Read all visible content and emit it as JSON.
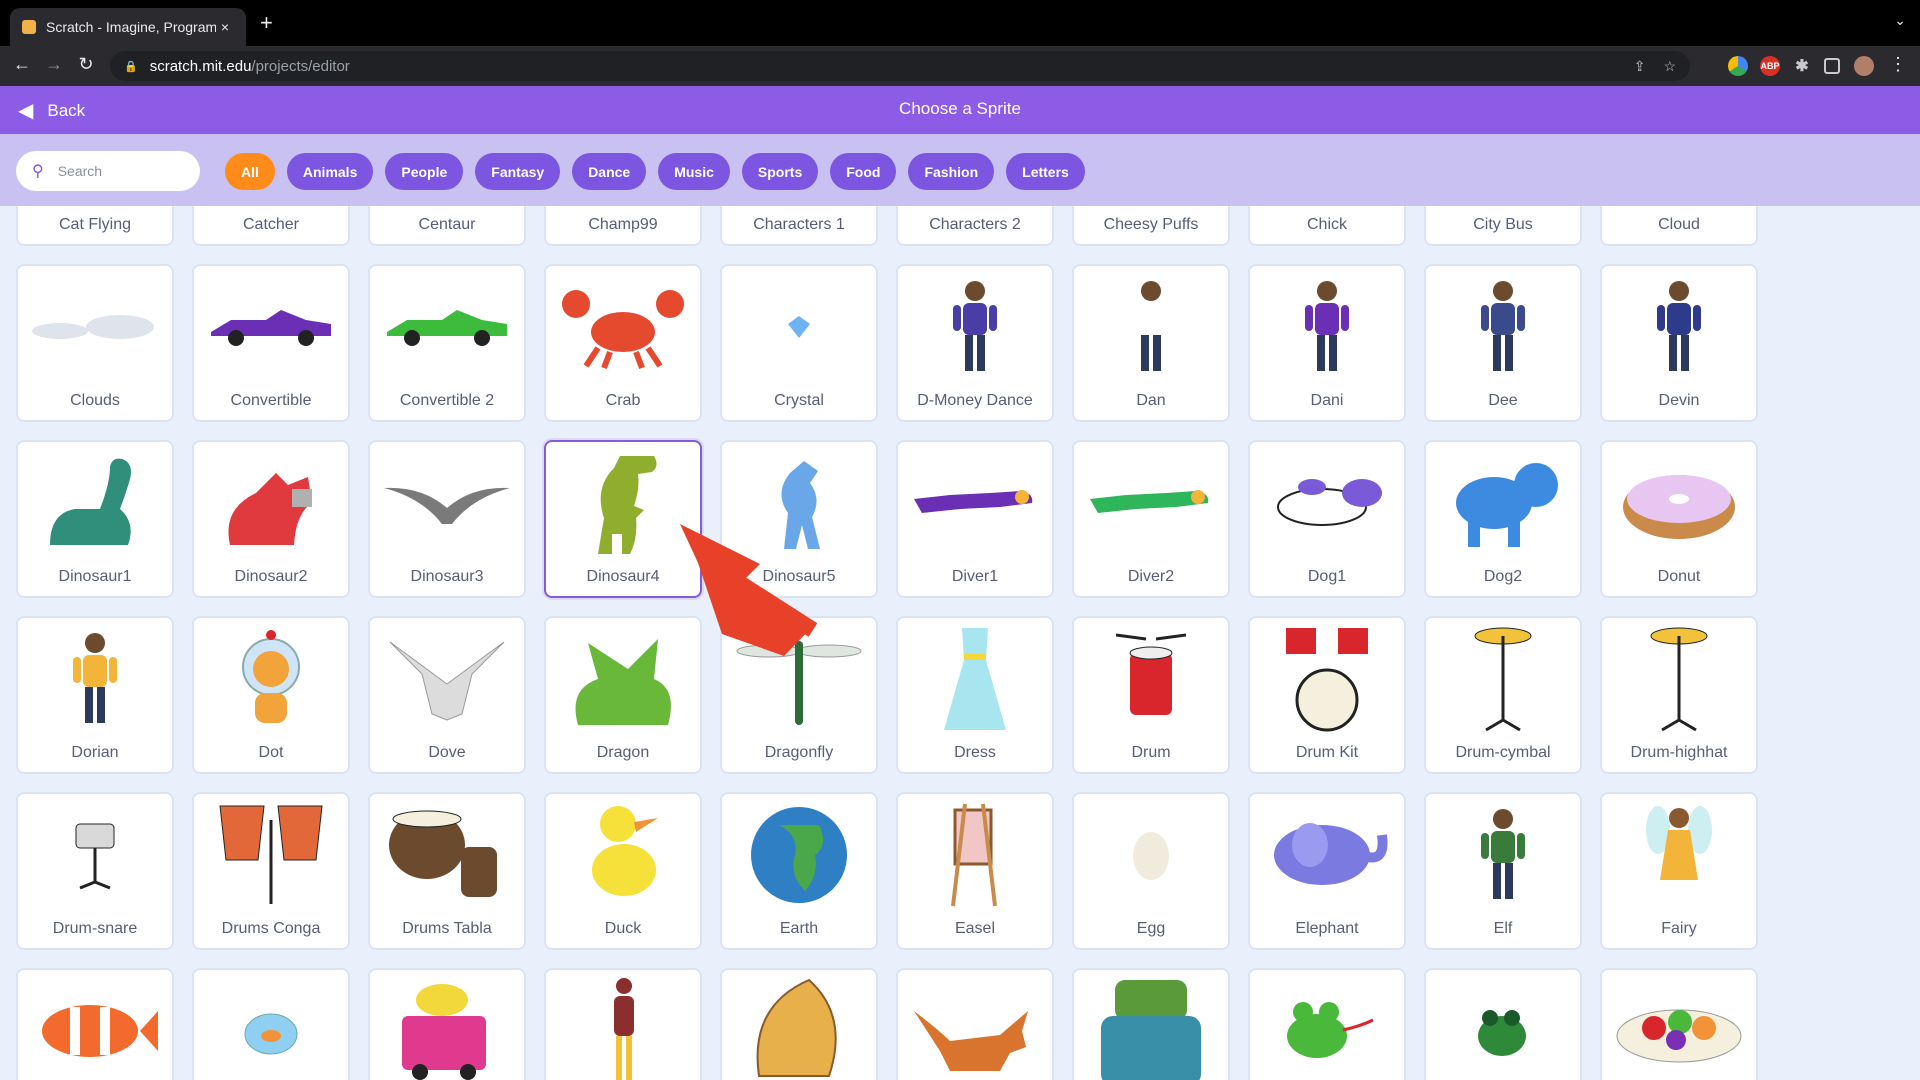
{
  "browser": {
    "tab_title": "Scratch - Imagine, Program, Share",
    "tab_close": "×",
    "new_tab": "+",
    "url_host": "scratch.mit.edu",
    "url_path": "/projects/editor",
    "extensions": [
      "drive-icon",
      "adblock-icon",
      "puzzle-icon",
      "sidepanel-icon",
      "profile-avatar"
    ]
  },
  "header": {
    "back_label": "Back",
    "title": "Choose a Sprite"
  },
  "search": {
    "placeholder": "Search",
    "value": ""
  },
  "categories": [
    {
      "label": "All",
      "active": true
    },
    {
      "label": "Animals",
      "active": false
    },
    {
      "label": "People",
      "active": false
    },
    {
      "label": "Fantasy",
      "active": false
    },
    {
      "label": "Dance",
      "active": false
    },
    {
      "label": "Music",
      "active": false
    },
    {
      "label": "Sports",
      "active": false
    },
    {
      "label": "Food",
      "active": false
    },
    {
      "label": "Fashion",
      "active": false
    },
    {
      "label": "Letters",
      "active": false
    }
  ],
  "sprites": [
    {
      "name": "Cat Flying",
      "icon": "cat-flying",
      "color": "#f7a934"
    },
    {
      "name": "Catcher",
      "icon": "catcher",
      "color": "#4c6ed8"
    },
    {
      "name": "Centaur",
      "icon": "centaur",
      "color": "#b07f4a"
    },
    {
      "name": "Champ99",
      "icon": "champ",
      "color": "#c43a3a"
    },
    {
      "name": "Characters 1",
      "icon": "characters",
      "color": "#6a5acd"
    },
    {
      "name": "Characters 2",
      "icon": "characters",
      "color": "#3a9fc4"
    },
    {
      "name": "Cheesy Puffs",
      "icon": "cheesy-puffs",
      "color": "#f6b53a"
    },
    {
      "name": "Chick",
      "icon": "chick",
      "color": "#f6d83a"
    },
    {
      "name": "City Bus",
      "icon": "city-bus",
      "color": "#e2473a"
    },
    {
      "name": "Cloud",
      "icon": "cloud",
      "color": "#dfe6ef"
    },
    {
      "name": "Clouds",
      "icon": "clouds",
      "color": "#dfe3ec"
    },
    {
      "name": "Convertible",
      "icon": "convertible",
      "color": "#6a2fb5"
    },
    {
      "name": "Convertible 2",
      "icon": "convertible2",
      "color": "#3dbb3d"
    },
    {
      "name": "Crab",
      "icon": "crab",
      "color": "#e64a2e"
    },
    {
      "name": "Crystal",
      "icon": "crystal",
      "color": "#6fb3f2"
    },
    {
      "name": "D-Money Dance",
      "icon": "person",
      "color": "#4a3da8"
    },
    {
      "name": "Dan",
      "icon": "person",
      "color": "#ffffff"
    },
    {
      "name": "Dani",
      "icon": "person",
      "color": "#6a2fb5"
    },
    {
      "name": "Dee",
      "icon": "person",
      "color": "#3b4a8a"
    },
    {
      "name": "Devin",
      "icon": "person",
      "color": "#2e3a8a"
    },
    {
      "name": "Dinosaur1",
      "icon": "dinosaur",
      "color": "#2f8f7a"
    },
    {
      "name": "Dinosaur2",
      "icon": "dinosaur2",
      "color": "#e0393e"
    },
    {
      "name": "Dinosaur3",
      "icon": "pterodactyl",
      "color": "#7a7a7a"
    },
    {
      "name": "Dinosaur4",
      "icon": "trex",
      "color": "#8fae2e"
    },
    {
      "name": "Dinosaur5",
      "icon": "dinosaur5",
      "color": "#6aa7e8"
    },
    {
      "name": "Diver1",
      "icon": "diver",
      "color": "#6a2fb5"
    },
    {
      "name": "Diver2",
      "icon": "diver",
      "color": "#2fb55a"
    },
    {
      "name": "Dog1",
      "icon": "dog1",
      "color": "#7a5ad6"
    },
    {
      "name": "Dog2",
      "icon": "dog2",
      "color": "#3d8be0"
    },
    {
      "name": "Donut",
      "icon": "donut",
      "color": "#c98a4a"
    },
    {
      "name": "Dorian",
      "icon": "person",
      "color": "#f2b53a"
    },
    {
      "name": "Dot",
      "icon": "dot",
      "color": "#f2a33a"
    },
    {
      "name": "Dove",
      "icon": "dove",
      "color": "#dcdcdc"
    },
    {
      "name": "Dragon",
      "icon": "dragon",
      "color": "#6ab83a"
    },
    {
      "name": "Dragonfly",
      "icon": "dragonfly",
      "color": "#2e6b3a"
    },
    {
      "name": "Dress",
      "icon": "dress",
      "color": "#a8e6ef"
    },
    {
      "name": "Drum",
      "icon": "drum",
      "color": "#d9262c"
    },
    {
      "name": "Drum Kit",
      "icon": "drum-kit",
      "color": "#d9262c"
    },
    {
      "name": "Drum-cymbal",
      "icon": "cymbal",
      "color": "#f2c33a"
    },
    {
      "name": "Drum-highhat",
      "icon": "cymbal",
      "color": "#f2c33a"
    },
    {
      "name": "Drum-snare",
      "icon": "snare",
      "color": "#d9d9d9"
    },
    {
      "name": "Drums Conga",
      "icon": "conga",
      "color": "#e2683a"
    },
    {
      "name": "Drums Tabla",
      "icon": "tabla",
      "color": "#6b4a2e"
    },
    {
      "name": "Duck",
      "icon": "duck",
      "color": "#f6e03a"
    },
    {
      "name": "Earth",
      "icon": "earth",
      "color": "#2f7fc4"
    },
    {
      "name": "Easel",
      "icon": "easel",
      "color": "#c98a4a"
    },
    {
      "name": "Egg",
      "icon": "egg",
      "color": "#f0ebdd"
    },
    {
      "name": "Elephant",
      "icon": "elephant",
      "color": "#7a7ae0"
    },
    {
      "name": "Elf",
      "icon": "person",
      "color": "#3a7a3a"
    },
    {
      "name": "Fairy",
      "icon": "fairy",
      "color": "#f2b53a"
    },
    {
      "name": "",
      "icon": "fish",
      "color": "#f26a2e"
    },
    {
      "name": "",
      "icon": "fishbowl",
      "color": "#8fd0f2"
    },
    {
      "name": "",
      "icon": "food-truck",
      "color": "#e03a8f"
    },
    {
      "name": "",
      "icon": "football",
      "color": "#8a2e2e"
    },
    {
      "name": "",
      "icon": "fortune-cookie",
      "color": "#e8b04a"
    },
    {
      "name": "",
      "icon": "fox",
      "color": "#d9742e"
    },
    {
      "name": "",
      "icon": "frank",
      "color": "#5a9a3a"
    },
    {
      "name": "",
      "icon": "frog",
      "color": "#4ab83a"
    },
    {
      "name": "",
      "icon": "frog2",
      "color": "#2e8a3a"
    },
    {
      "name": "",
      "icon": "fruit-salad",
      "color": "#d9262c"
    }
  ],
  "selected_sprite": "Dinosaur4",
  "annotation_color": "#e8412a"
}
